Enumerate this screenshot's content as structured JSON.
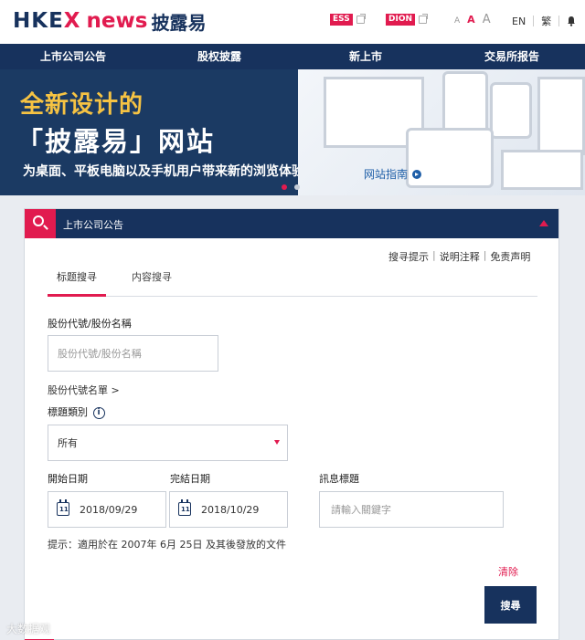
{
  "header": {
    "logo_hkex": "HKE",
    "logo_x": "X",
    "logo_news": "news",
    "logo_cn": "披露易",
    "ess_label": "ESS",
    "dion_label": "DION",
    "font_sizes": [
      "A",
      "A",
      "A"
    ],
    "lang_en": "EN",
    "lang_tc": "繁"
  },
  "nav": {
    "items": [
      "上市公司公告",
      "股权披露",
      "新上市",
      "交易所报告"
    ]
  },
  "banner": {
    "title_line1": "全新设计的",
    "title_line2": "「披露易」网站",
    "subtitle": "为桌面、平板电脑以及手机用户带来新的浏览体验",
    "guide_link": "网站指南"
  },
  "panel": {
    "title": "上市公司公告",
    "help_links": [
      "搜寻提示",
      "说明注释",
      "免责声明"
    ],
    "help_sep": "|",
    "tabs": [
      "标题搜寻",
      "内容搜寻"
    ],
    "stock_label": "股份代號/股份名稱",
    "stock_placeholder": "股份代號/股份名稱",
    "stock_list_link": "股份代號名單 >",
    "category_label": "標題類別",
    "category_value": "所有",
    "start_label": "開始日期",
    "end_label": "完結日期",
    "headline_label": "訊息標題",
    "start_date": "2018/09/29",
    "end_date": "2018/10/29",
    "calendar_day": "11",
    "headline_placeholder": "請輸入關鍵字",
    "hint": "提示：適用於在 2007年 6月 25日 及其後發放的文件",
    "clear_label": "清除",
    "search_label": "搜尋"
  },
  "watermark": "大数据观",
  "colors": {
    "navy": "#17325d",
    "accent_red": "#e11b4f",
    "gold": "#f6c343"
  }
}
